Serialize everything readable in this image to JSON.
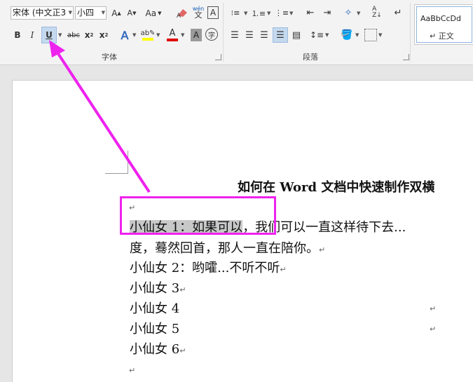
{
  "ribbon": {
    "font_name": "宋体 (中文正3",
    "font_size": "小四",
    "groups": {
      "font": "字体",
      "paragraph": "段落"
    },
    "pinyin_top": "wén",
    "pinyin_bottom": "文",
    "style_preview": "AaBbCcDd",
    "style_name": "↵ 正文"
  },
  "doc": {
    "title": "如何在 Word 文档中快速制作双横",
    "lines": [
      {
        "highlighted": "小仙女 1：如果可以",
        "rest": "，我们可以一直这样待下去..."
      },
      {
        "text": "度，蓦然回首，那人一直在陪你。",
        "mark": "↵"
      },
      {
        "text": "小仙女 2：哟嚯...不听不听",
        "mark": "↵"
      },
      {
        "text": "小仙女 3",
        "mark": "↵"
      },
      {
        "text": "小仙女 4",
        "mark": ""
      },
      {
        "text": "小仙女 5",
        "mark": ""
      },
      {
        "text": "小仙女 6",
        "mark": "↵"
      }
    ],
    "pilcrow": "↵"
  },
  "accent_colors": {
    "callout": "#ee22ee",
    "highlight_yellow": "#ffff00",
    "font_red": "#e00000"
  }
}
